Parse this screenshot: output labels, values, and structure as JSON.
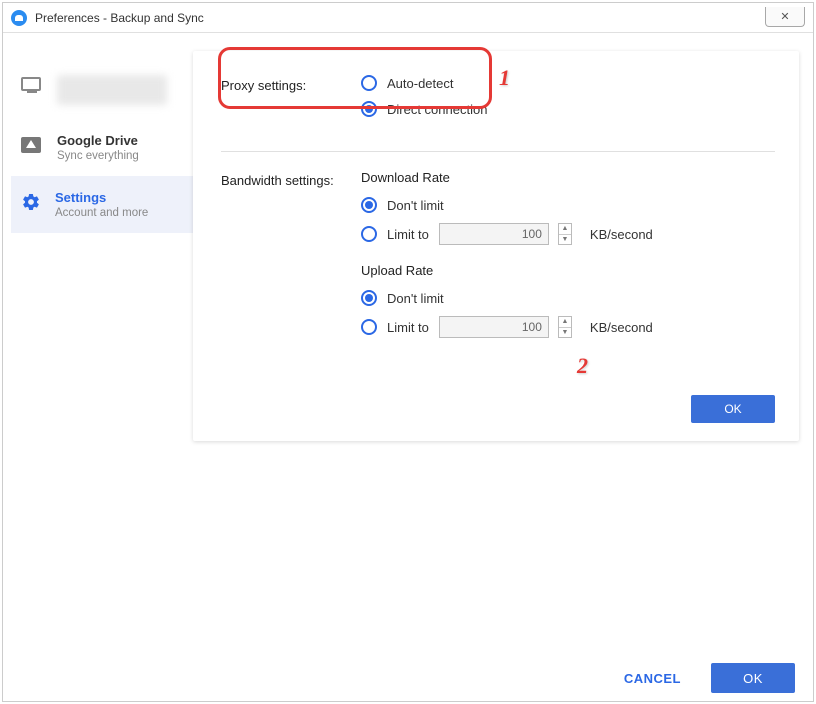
{
  "window": {
    "title": "Preferences - Backup and Sync",
    "close": "✕"
  },
  "sidebar": {
    "items": [
      {
        "title": "",
        "sub": ""
      },
      {
        "title": "Google Drive",
        "sub": "Sync everything"
      },
      {
        "title": "Settings",
        "sub": "Account and more"
      }
    ]
  },
  "panel": {
    "proxy": {
      "label": "Proxy settings:",
      "auto": "Auto-detect",
      "direct": "Direct connection"
    },
    "bandwidth": {
      "label": "Bandwidth settings:",
      "download": {
        "header": "Download Rate",
        "dont_limit": "Don't limit",
        "limit_to": "Limit to",
        "value": "100",
        "unit": "KB/second"
      },
      "upload": {
        "header": "Upload Rate",
        "dont_limit": "Don't limit",
        "limit_to": "Limit to",
        "value": "100",
        "unit": "KB/second"
      }
    },
    "ok": "OK"
  },
  "footer": {
    "cancel": "CANCEL",
    "ok": "OK"
  },
  "annotations": {
    "one": "1",
    "two": "2"
  }
}
